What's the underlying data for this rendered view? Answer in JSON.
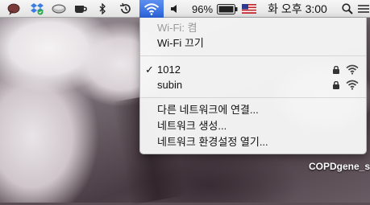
{
  "menubar": {
    "battery_percent": "96%",
    "clock": "화 오후 3:00",
    "status_icons": [
      "speech-bubble-icon",
      "dropbox-icon",
      "cloud-app-icon",
      "coffee-cup-icon",
      "bluetooth-icon",
      "time-machine-icon",
      "wifi-icon",
      "volume-icon",
      "battery-icon",
      "flag-icon",
      "spotlight-icon",
      "list-icon"
    ]
  },
  "wifi_menu": {
    "status": "Wi-Fi: 켬",
    "toggle_label": "Wi-Fi 끄기",
    "networks": [
      {
        "name": "1012",
        "selected": true,
        "locked": true
      },
      {
        "name": "subin",
        "selected": false,
        "locked": true
      }
    ],
    "selected_mark": "✓",
    "join_other": "다른 네트워크에 연결...",
    "create_network": "네트워크 생성...",
    "open_prefs": "네트워크 환경설정 열기..."
  },
  "desktop": {
    "file_label": "COPDgene_s"
  },
  "colors": {
    "menu_highlight": "#2a62d9",
    "menubar_top": "#f6f6f6"
  }
}
